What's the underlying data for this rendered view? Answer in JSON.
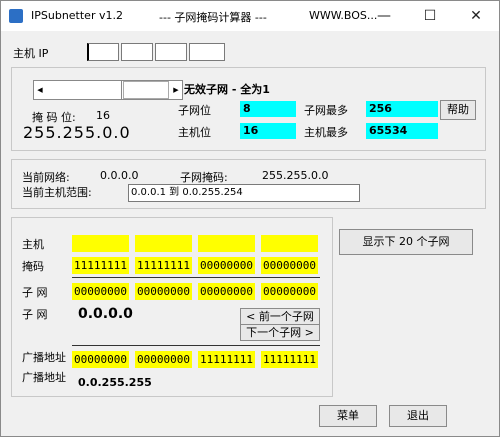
{
  "window": {
    "title": "IPSubnetter v1.2",
    "subtitle": "--- 子网掩码计算器 ---",
    "url": "WWW.BOS...",
    "minimize": "—",
    "maximize": "☐",
    "close": "✕"
  },
  "ip": {
    "label": "主机 IP"
  },
  "mask_panel": {
    "scroll_left": "◀",
    "scroll_right": "▶",
    "mask_bits_label": "掩 码 位:",
    "mask_bits_value": "16",
    "mask": "255.255.0.0",
    "status": "无效子网 - 全为1",
    "subnet_bits_label": "子网位",
    "subnet_bits_value": "8",
    "max_subnets_label": "子网最多",
    "max_subnets_value": "256",
    "help_button": "帮助",
    "host_bits_label": "主机位",
    "host_bits_value": "16",
    "max_hosts_label": "主机最多",
    "max_hosts_value": "65534"
  },
  "network_panel": {
    "current_network_label": "当前网络:",
    "current_network_value": "0.0.0.0",
    "subnet_mask_label": "子网掩码:",
    "subnet_mask_value": "255.255.0.0",
    "host_range_label": "当前主机范围:",
    "host_range_value": "0.0.0.1  到  0.0.255.254"
  },
  "bits_panel": {
    "host_label": "主机",
    "mask_label": "掩码",
    "mask_octets": [
      "11111111",
      "11111111",
      "00000000",
      "00000000"
    ],
    "subnet_label1": "子 网",
    "subnet_octets": [
      "00000000",
      "00000000",
      "00000000",
      "00000000"
    ],
    "subnet_label2": "子 网",
    "subnet_value": "0.0.0.0",
    "prev_subnet_button": "< 前一个子网",
    "next_subnet_button": "下一个子网 >",
    "broadcast_label1": "广播地址",
    "broadcast_octets": [
      "00000000",
      "00000000",
      "11111111",
      "11111111"
    ],
    "broadcast_label2": "广播地址",
    "broadcast_value": "0.0.255.255"
  },
  "show_subnets_button": "显示下 20 个子网",
  "menu_button": "菜单",
  "exit_button": "退出",
  "colors": {
    "cyan": "#00ffff",
    "yellow": "#ffff00"
  }
}
